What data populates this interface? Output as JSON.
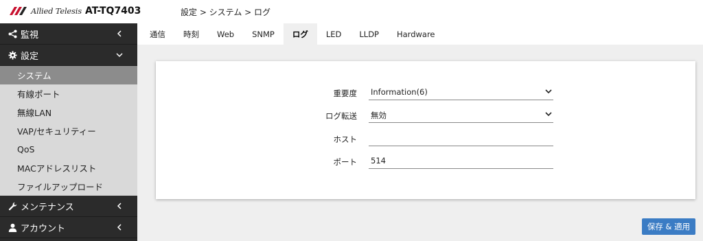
{
  "header": {
    "brand": "Allied Telesis",
    "model": "AT-TQ7403",
    "breadcrumb": "設定 > システム > ログ"
  },
  "sidebar": {
    "monitor_label": "監視",
    "settings_label": "設定",
    "sub_items": [
      "システム",
      "有線ポート",
      "無線LAN",
      "VAP/セキュリティー",
      "QoS",
      "MACアドレスリスト",
      "ファイルアップロード"
    ],
    "maintenance_label": "メンテナンス",
    "account_label": "アカウント"
  },
  "tabs": [
    "通信",
    "時刻",
    "Web",
    "SNMP",
    "ログ",
    "LED",
    "LLDP",
    "Hardware"
  ],
  "active_tab": "ログ",
  "form": {
    "severity": {
      "label": "重要度",
      "value": "Information(6)"
    },
    "forward": {
      "label": "ログ転送",
      "value": "無効"
    },
    "host": {
      "label": "ホスト",
      "value": ""
    },
    "port": {
      "label": "ポート",
      "value": "514"
    }
  },
  "save_button": "保存 & 適用",
  "colors": {
    "accent": "#3b7cc4",
    "sidebar_dark": "#2b2b2b",
    "sidebar_active": "#8c8c8c",
    "brand_red": "#c8102e"
  }
}
